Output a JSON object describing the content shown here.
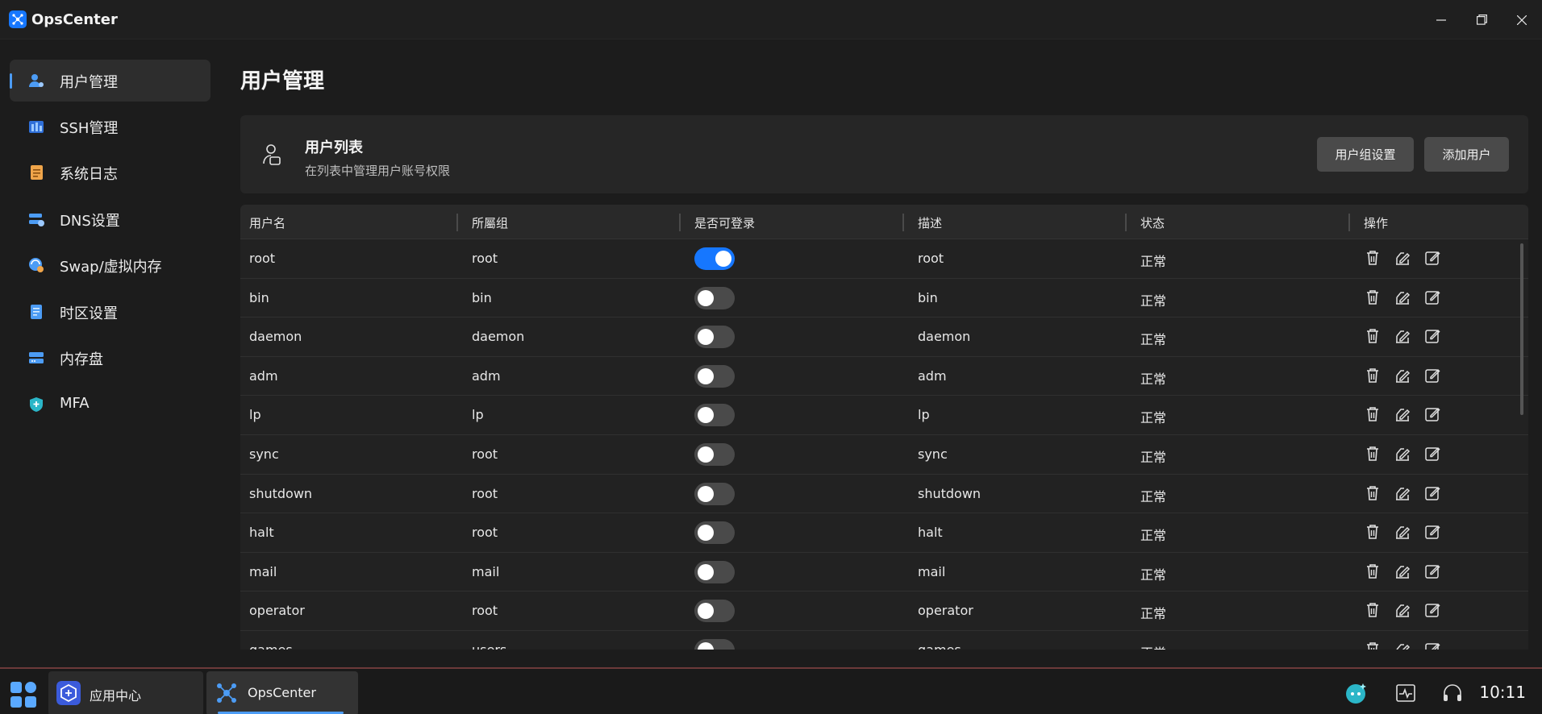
{
  "app": {
    "title": "OpsCenter"
  },
  "sidebar": {
    "items": [
      {
        "label": "用户管理",
        "icon": "user-gear-icon",
        "active": true
      },
      {
        "label": "SSH管理",
        "icon": "server-icon",
        "active": false
      },
      {
        "label": "系统日志",
        "icon": "log-file-icon",
        "active": false
      },
      {
        "label": "DNS设置",
        "icon": "dns-icon",
        "active": false
      },
      {
        "label": "Swap/虚拟内存",
        "icon": "swap-memory-icon",
        "active": false
      },
      {
        "label": "时区设置",
        "icon": "timezone-icon",
        "active": false
      },
      {
        "label": "内存盘",
        "icon": "ramdisk-icon",
        "active": false
      },
      {
        "label": "MFA",
        "icon": "shield-icon",
        "active": false
      }
    ]
  },
  "main": {
    "title": "用户管理",
    "card": {
      "title": "用户列表",
      "subtitle": "在列表中管理用户账号权限",
      "group_button": "用户组设置",
      "add_button": "添加用户"
    },
    "table": {
      "columns": [
        "用户名",
        "所屬组",
        "是否可登录",
        "描述",
        "状态",
        "操作"
      ],
      "rows": [
        {
          "name": "root",
          "group": "root",
          "login": true,
          "desc": "root",
          "status": "正常"
        },
        {
          "name": "bin",
          "group": "bin",
          "login": false,
          "desc": "bin",
          "status": "正常"
        },
        {
          "name": "daemon",
          "group": "daemon",
          "login": false,
          "desc": "daemon",
          "status": "正常"
        },
        {
          "name": "adm",
          "group": "adm",
          "login": false,
          "desc": "adm",
          "status": "正常"
        },
        {
          "name": "lp",
          "group": "lp",
          "login": false,
          "desc": "lp",
          "status": "正常"
        },
        {
          "name": "sync",
          "group": "root",
          "login": false,
          "desc": "sync",
          "status": "正常"
        },
        {
          "name": "shutdown",
          "group": "root",
          "login": false,
          "desc": "shutdown",
          "status": "正常"
        },
        {
          "name": "halt",
          "group": "root",
          "login": false,
          "desc": "halt",
          "status": "正常"
        },
        {
          "name": "mail",
          "group": "mail",
          "login": false,
          "desc": "mail",
          "status": "正常"
        },
        {
          "name": "operator",
          "group": "root",
          "login": false,
          "desc": "operator",
          "status": "正常"
        },
        {
          "name": "games",
          "group": "users",
          "login": false,
          "desc": "games",
          "status": "正常"
        }
      ]
    }
  },
  "taskbar": {
    "apps": [
      {
        "label": "应用中心",
        "icon": "app-center-icon"
      },
      {
        "label": "OpsCenter",
        "icon": "opscenter-icon"
      }
    ],
    "clock": "10:11"
  },
  "colors": {
    "accent": "#1677ff",
    "background": "#1c1c1c",
    "panel": "#262626"
  }
}
